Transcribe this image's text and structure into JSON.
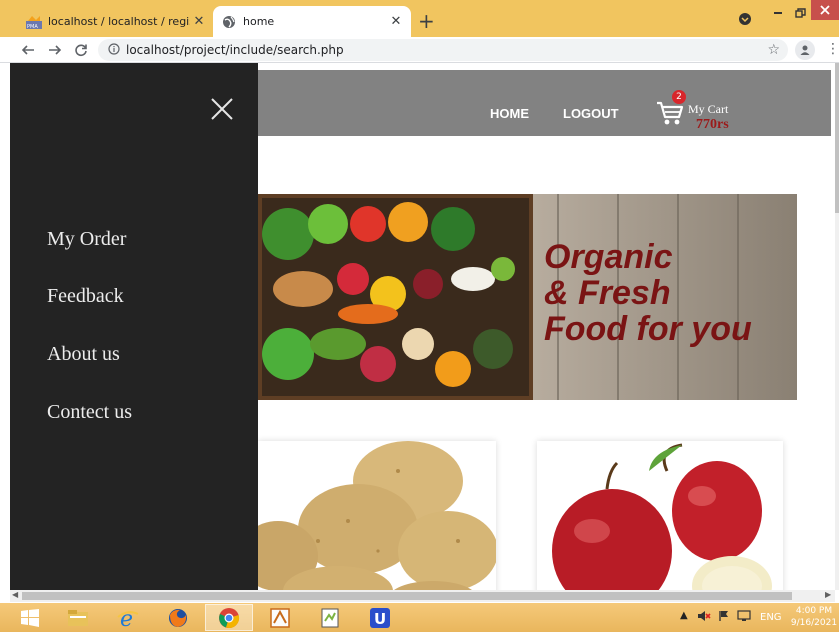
{
  "browser": {
    "tabs": [
      {
        "title": "localhost / localhost / register / s",
        "active": false,
        "favicon": "phpmyadmin-icon"
      },
      {
        "title": "home",
        "active": true,
        "favicon": "globe-icon"
      }
    ],
    "new_tab_label": "+",
    "close_label": "✕",
    "url": "localhost/project/include/search.php"
  },
  "sidenav": {
    "close_label": "close",
    "items": [
      {
        "label": "My Order"
      },
      {
        "label": "Feedback"
      },
      {
        "label": "About us"
      },
      {
        "label": "Contect us"
      }
    ]
  },
  "header": {
    "nav": [
      {
        "label": "HOME"
      },
      {
        "label": "LOGOUT"
      }
    ],
    "cart": {
      "label": "My Cart",
      "count": "2",
      "total": "770rs"
    }
  },
  "banner": {
    "lines": [
      "Organic",
      "& Fresh",
      "Food for you"
    ]
  },
  "products": [
    {
      "name": "potato",
      "image": "potato-image"
    },
    {
      "name": "apple",
      "image": "apple-image"
    }
  ],
  "taskbar": {
    "language": "ENG",
    "time": "4:00 PM",
    "date": "9/16/2021"
  },
  "colors": {
    "tab_strip": "#f1c55f",
    "header_band": "#828282",
    "sidenav_bg": "#232323",
    "cart_total": "#9b1b1b",
    "banner_text": "#7a1414"
  }
}
